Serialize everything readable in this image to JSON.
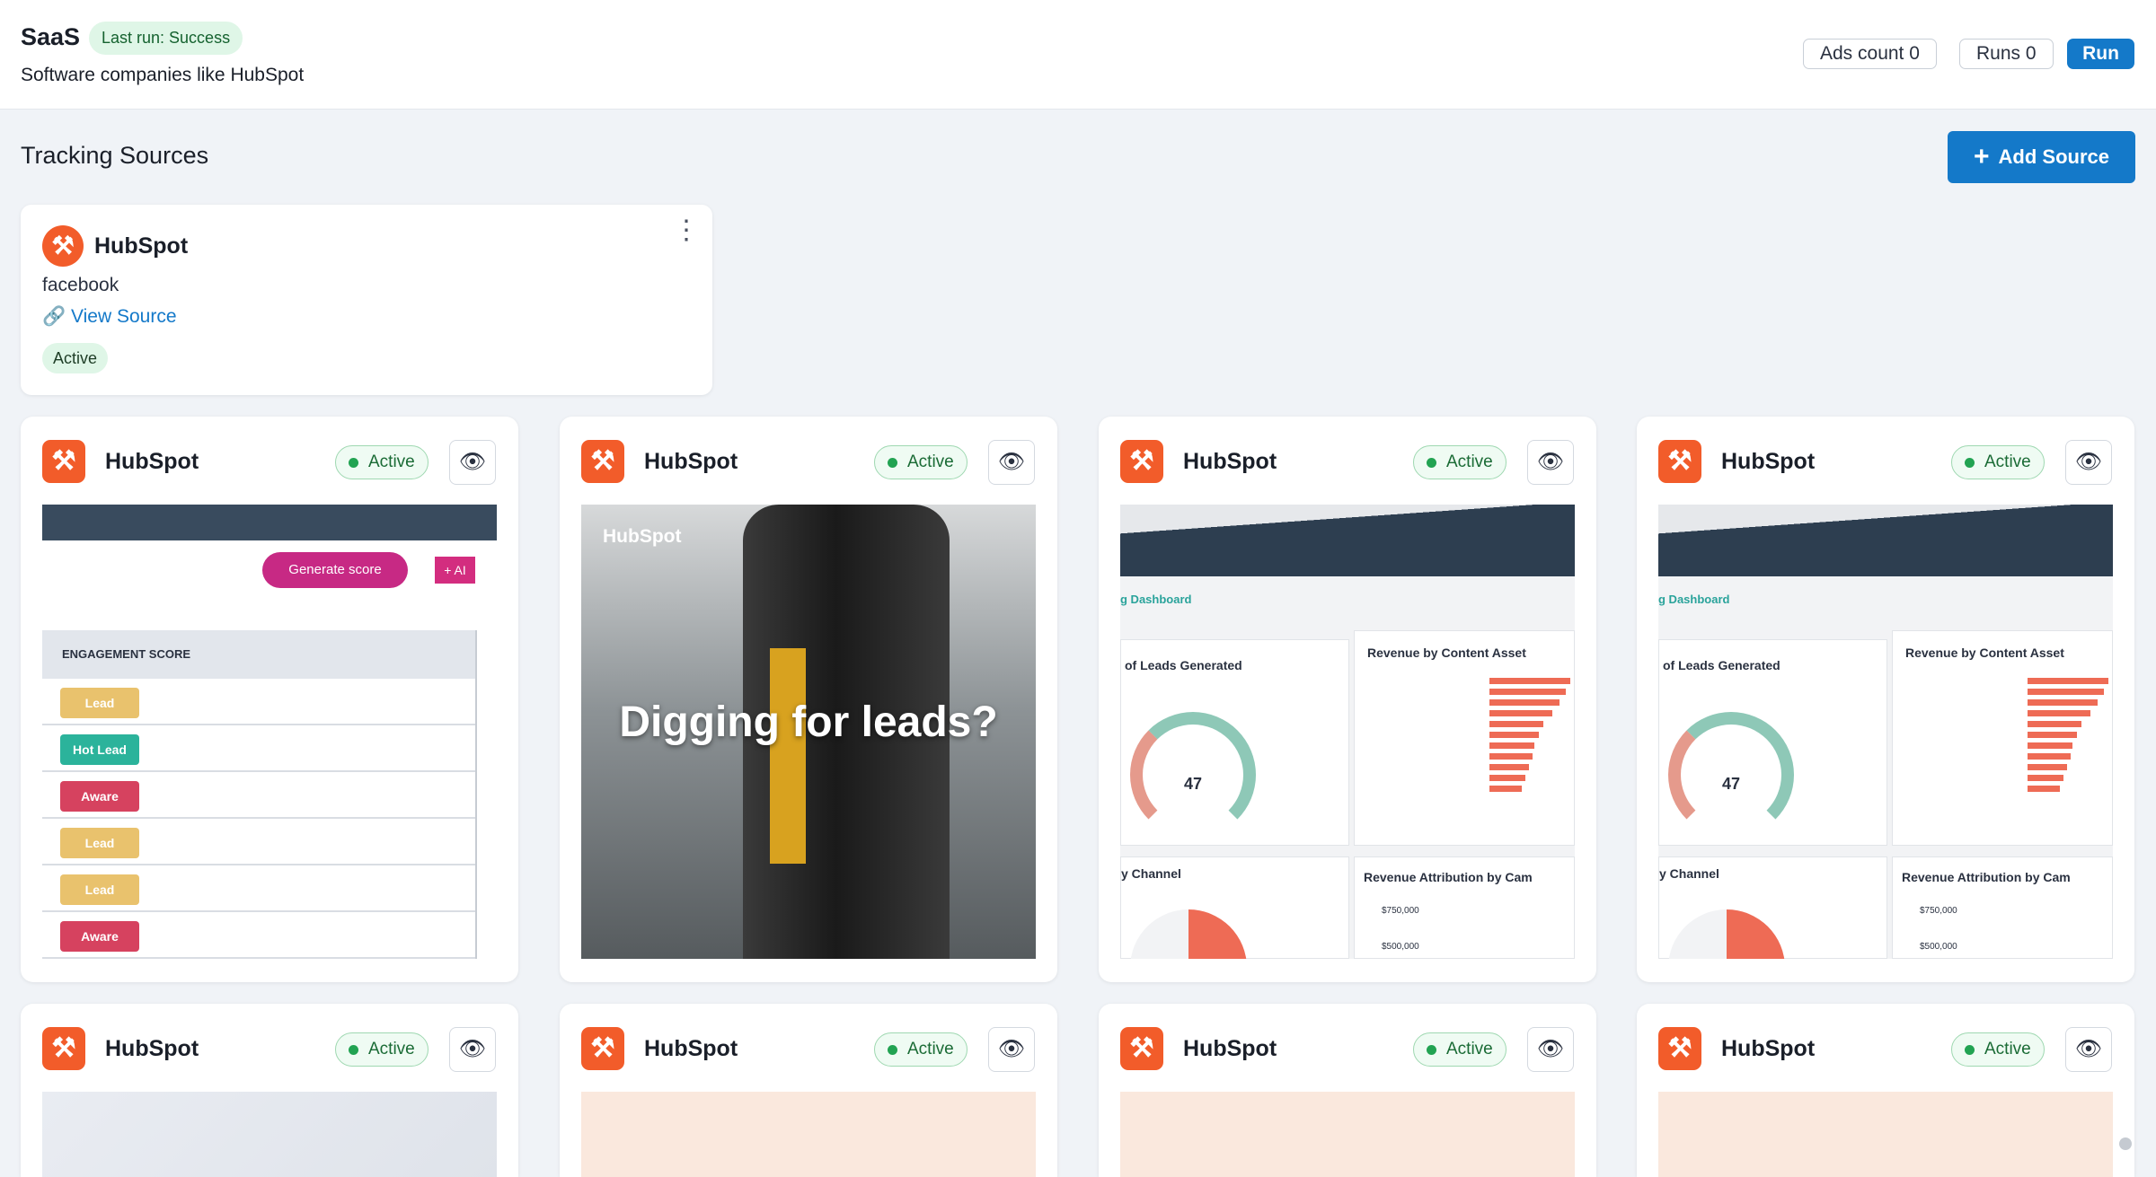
{
  "header": {
    "title": "SaaS",
    "run_status": "Last run: Success",
    "subtitle": "Software companies like HubSpot",
    "ads_count_label": "Ads count 0",
    "runs_label": "Runs 0",
    "run_button": "Run"
  },
  "tracking": {
    "section_title": "Tracking Sources",
    "add_source_label": "Add Source"
  },
  "source": {
    "name": "HubSpot",
    "platform": "facebook",
    "view_link": "View Source",
    "status": "Active"
  },
  "ads": [
    {
      "advertiser": "HubSpot",
      "status": "Active"
    },
    {
      "advertiser": "HubSpot",
      "status": "Active"
    },
    {
      "advertiser": "HubSpot",
      "status": "Active"
    },
    {
      "advertiser": "HubSpot",
      "status": "Active"
    },
    {
      "advertiser": "HubSpot",
      "status": "Active"
    },
    {
      "advertiser": "HubSpot",
      "status": "Active"
    },
    {
      "advertiser": "HubSpot",
      "status": "Active"
    },
    {
      "advertiser": "HubSpot",
      "status": "Active"
    }
  ],
  "creative_engagement": {
    "generate_button": "Generate score",
    "ai_badge": "+ AI",
    "table_header": "ENGAGEMENT SCORE",
    "rows": [
      {
        "label": "Lead",
        "color": "#e9c26d"
      },
      {
        "label": "Hot Lead",
        "color": "#2bb39b"
      },
      {
        "label": "Aware",
        "color": "#d6425f"
      },
      {
        "label": "Lead",
        "color": "#e9c26d"
      },
      {
        "label": "Lead",
        "color": "#e9c26d"
      },
      {
        "label": "Aware",
        "color": "#d6425f"
      }
    ]
  },
  "creative_digging": {
    "brand": "HubSpot",
    "headline": "Digging for leads?"
  },
  "creative_dashboard": {
    "dashboard_title": "g Dashboard",
    "leads_title": "of Leads Generated",
    "gauge_value": "47",
    "revenue_title": "Revenue by Content Asset",
    "channel_title": "y Channel",
    "attribution_title": "Revenue Attribution by Cam",
    "attribution_values": [
      "$750,000",
      "$500,000"
    ]
  },
  "colors": {
    "accent": "#1479c9",
    "hubspot_orange": "#f25c2a",
    "active_green": "#22a352"
  }
}
